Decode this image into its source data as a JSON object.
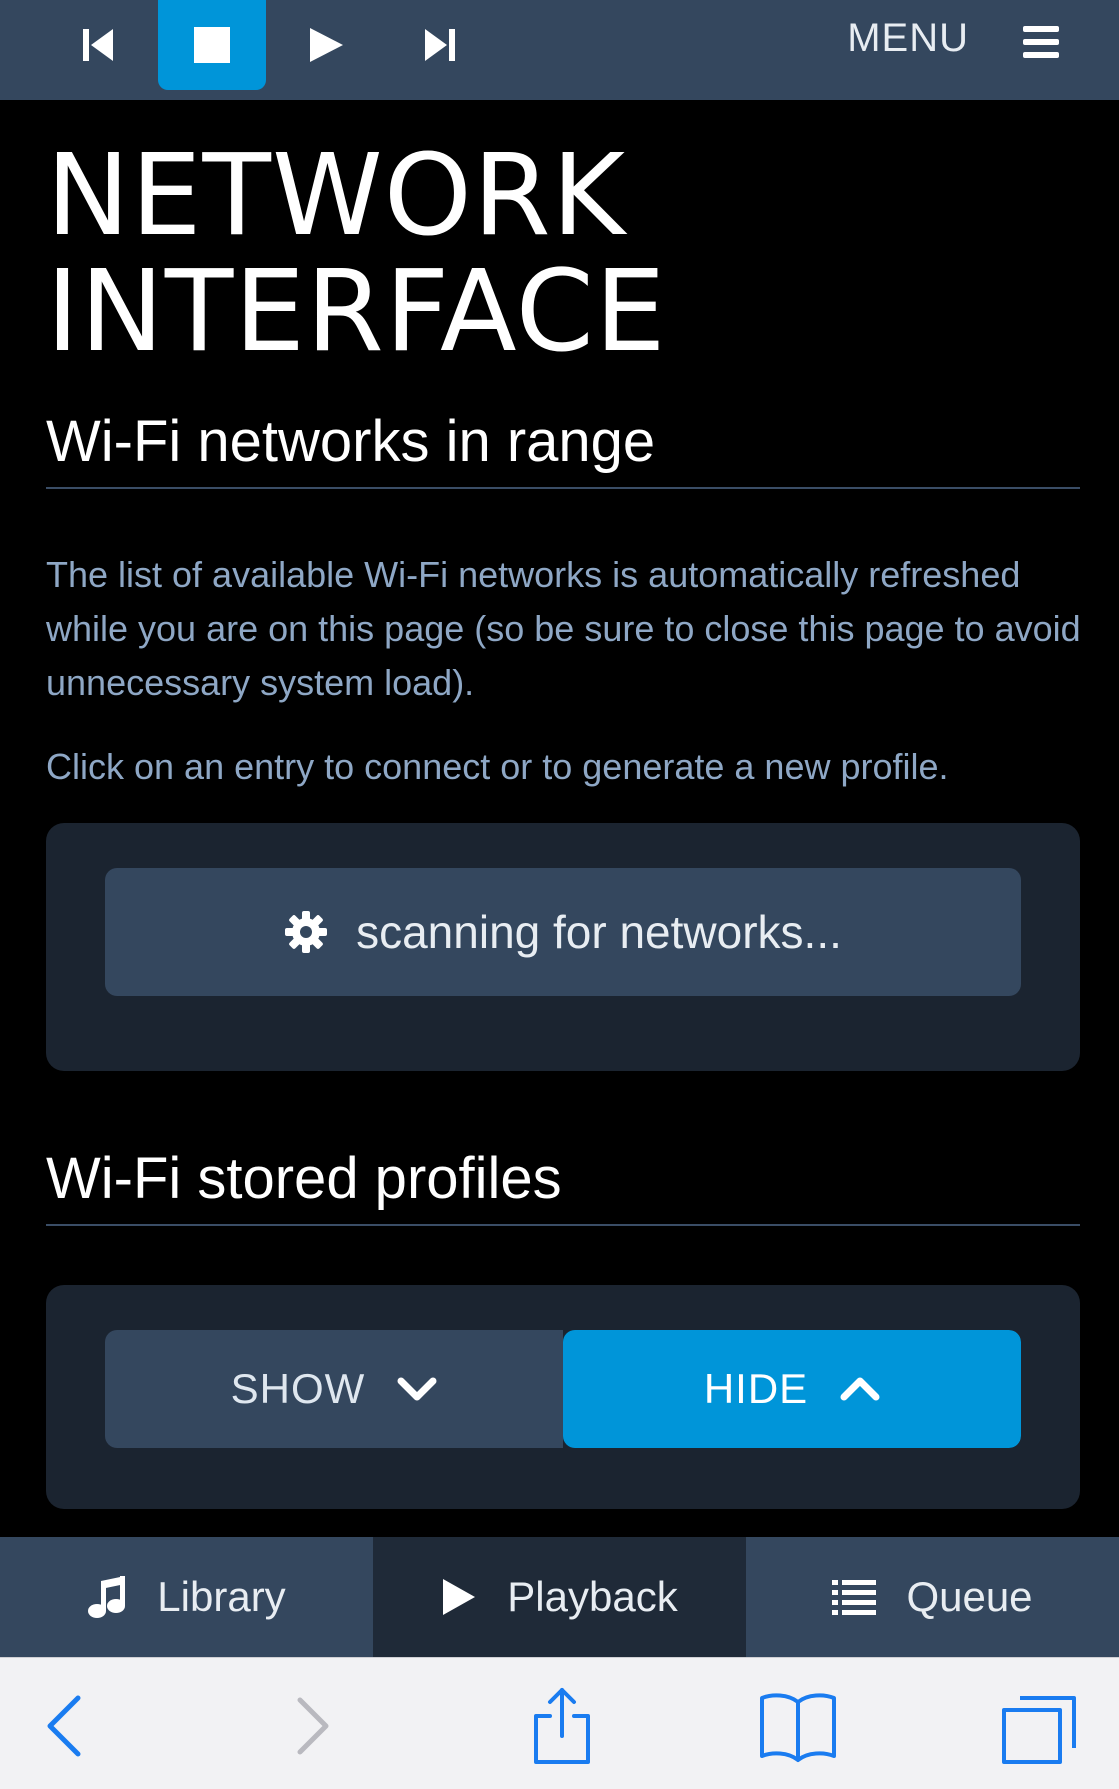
{
  "topbar": {
    "menu_label": "MENU",
    "colors": {
      "bar": "#34475e",
      "active": "#0095d9"
    },
    "buttons": [
      {
        "name": "previous",
        "icon": "skip-back-icon",
        "active": false
      },
      {
        "name": "stop",
        "icon": "stop-icon",
        "active": true
      },
      {
        "name": "play",
        "icon": "play-icon",
        "active": false
      },
      {
        "name": "next",
        "icon": "skip-forward-icon",
        "active": false
      }
    ]
  },
  "page": {
    "title_line1": "NETWORK",
    "title_line2": "INTERFACE"
  },
  "wifi_range": {
    "heading": "Wi-Fi networks in range",
    "info1": "The list of available Wi-Fi networks is automatically refreshed while you are on this page (so be sure to close this page to avoid unnecessary system load).",
    "info2": "Click on an entry to connect or to generate a new profile.",
    "scan_label": "scanning for networks...",
    "scan_icon": "gear-icon"
  },
  "wifi_profiles": {
    "heading": "Wi-Fi stored profiles",
    "show_label": "SHOW",
    "hide_label": "HIDE",
    "selected": "HIDE"
  },
  "tabs": [
    {
      "label": "Library",
      "icon": "music-note-icon",
      "active": false
    },
    {
      "label": "Playback",
      "icon": "play-icon",
      "active": true
    },
    {
      "label": "Queue",
      "icon": "list-icon",
      "active": false
    }
  ],
  "browser": {
    "buttons": [
      "back-icon",
      "forward-icon",
      "share-icon",
      "bookmarks-icon",
      "tabs-icon"
    ],
    "accent": "#1a7cf0"
  }
}
